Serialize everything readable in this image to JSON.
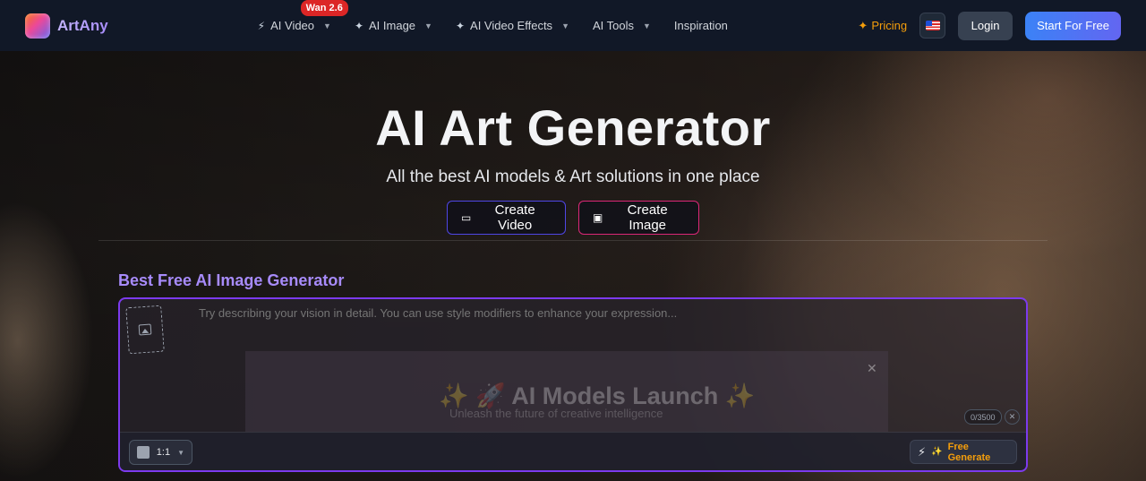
{
  "brand": {
    "name": "ArtAny"
  },
  "nav": {
    "items": [
      {
        "label": "AI Video",
        "badge": "Wan 2.6",
        "icon": "bolt-icon"
      },
      {
        "label": "AI Image",
        "icon": "sparkle-icon"
      },
      {
        "label": "AI Video Effects",
        "icon": "sparkle-icon"
      },
      {
        "label": "AI Tools"
      },
      {
        "label": "Inspiration"
      }
    ],
    "pricing": "Pricing",
    "login": "Login",
    "start": "Start For Free"
  },
  "hero": {
    "title": "AI Art Generator",
    "subtitle": "All the best AI models & Art solutions in one place",
    "create_video": "Create Video",
    "create_image": "Create Image"
  },
  "generator": {
    "title": "Best Free AI Image Generator",
    "placeholder": "Try describing your vision in detail. You can use style modifiers to enhance your expression...",
    "promo_title": "✨ 🚀 AI Models Launch ✨",
    "promo_sub": "Unleash the future of creative intelligence",
    "counter": "0/3500",
    "ratio": "1:1",
    "generate": "Free Generate"
  },
  "colors": {
    "accent": "#7c3aed",
    "pricing": "#f59e0b",
    "badge": "#dc2626",
    "start_button": "#4f63f0"
  }
}
